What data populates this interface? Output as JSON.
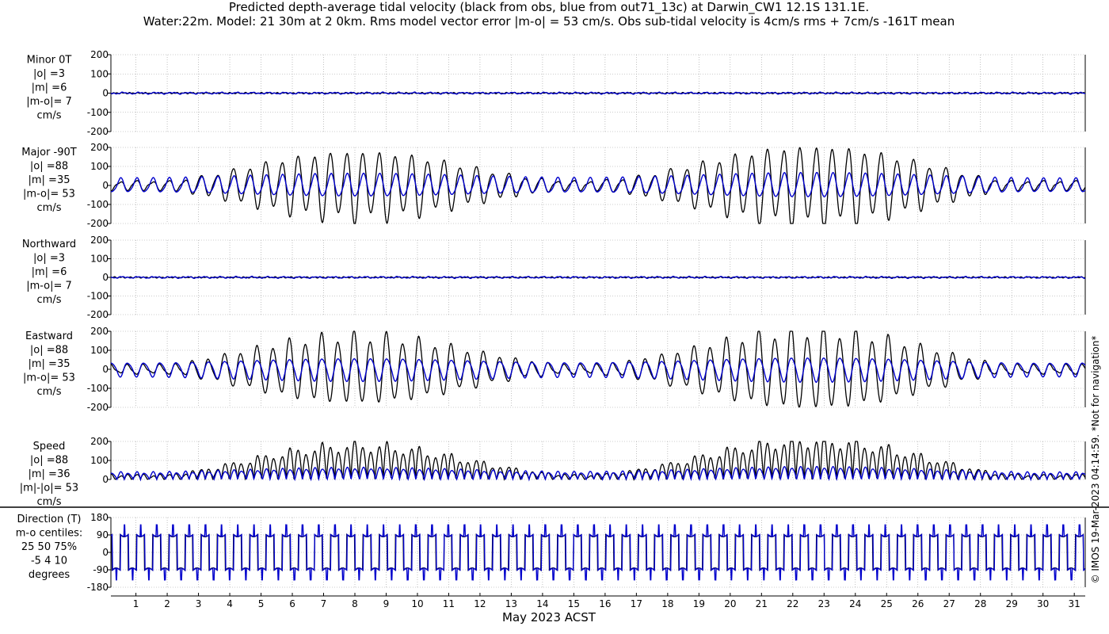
{
  "title_lines": [
    "Predicted depth-average tidal velocity (black from obs, blue from out71_13c) at Darwin_CW1 12.1S 131.1E.",
    "Water:22m. Model: 21 30m at 2 0km. Rms model vector error |m-o| = 53 cm/s. Obs sub-tidal velocity is 4cm/s rms + 7cm/s -161T mean"
  ],
  "xlabel": "May 2023 ACST",
  "watermark": "© IMOS 19-Mar-2023 04:14:59. *Not for navigation*",
  "colors": {
    "obs": "#000000",
    "model": "#0000cc",
    "grid": "#9a9a9a"
  },
  "chart_data": {
    "type": "line",
    "x_axis": {
      "unit": "day of May 2023",
      "range": [
        0.2,
        31.35
      ],
      "tick_labels": [
        "1",
        "2",
        "3",
        "4",
        "5",
        "6",
        "7",
        "8",
        "9",
        "10",
        "11",
        "12",
        "13",
        "14",
        "15",
        "16",
        "17",
        "18",
        "19",
        "20",
        "21",
        "22",
        "23",
        "24",
        "25",
        "26",
        "27",
        "28",
        "29",
        "30",
        "31"
      ]
    },
    "series_colors": {
      "obs": "black",
      "model": "blue"
    },
    "tidal_constituents_note": "mixed semidiurnal tide with spring tides near 7-9 May and 20-22 May, neap near 14 May and 27-29 May",
    "panels": [
      {
        "key": "minor",
        "labels": [
          "Minor 0T",
          "|o| =3",
          "|m| =6",
          "|m-o|= 7",
          "cm/s"
        ],
        "ylim": [
          -200,
          200
        ],
        "yticks": [
          200,
          100,
          0,
          -100,
          -200
        ],
        "obs_rms": 3,
        "model_rms": 6,
        "error_rms": 7
      },
      {
        "key": "major",
        "labels": [
          "Major -90T",
          "|o| =88",
          "|m| =35",
          "|m-o|= 53",
          "cm/s"
        ],
        "ylim": [
          -200,
          200
        ],
        "yticks": [
          200,
          100,
          0,
          -100,
          -200
        ],
        "obs_rms": 88,
        "model_rms": 35,
        "error_rms": 53
      },
      {
        "key": "northward",
        "labels": [
          "Northward",
          "|o| =3",
          "|m| =6",
          "|m-o|= 7",
          "cm/s"
        ],
        "ylim": [
          -200,
          200
        ],
        "yticks": [
          200,
          100,
          0,
          -100,
          -200
        ],
        "obs_rms": 3,
        "model_rms": 6,
        "error_rms": 7
      },
      {
        "key": "eastward",
        "labels": [
          "Eastward",
          "|o| =88",
          "|m| =35",
          "|m-o|= 53",
          "cm/s"
        ],
        "ylim": [
          -200,
          200
        ],
        "yticks": [
          200,
          100,
          0,
          -100,
          -200
        ],
        "obs_rms": 88,
        "model_rms": 35,
        "error_rms": 53
      },
      {
        "key": "speed",
        "labels": [
          "Speed",
          "|o| =88",
          "|m| =36",
          "|m|-|o|= 53",
          "cm/s"
        ],
        "ylim": [
          0,
          200
        ],
        "yticks": [
          200,
          100,
          0
        ],
        "obs_rms": 88,
        "model_rms": 36,
        "error_rms": 53
      },
      {
        "key": "direction",
        "labels": [
          "Direction (T)",
          "m-o centiles:",
          "25  50  75%",
          "-5  4 10",
          "degrees"
        ],
        "ylim": [
          -180,
          180
        ],
        "yticks": [
          180,
          90,
          0,
          -90,
          -180
        ],
        "centiles": {
          "p25": -5,
          "p50": 4,
          "p75": 10
        }
      }
    ]
  }
}
